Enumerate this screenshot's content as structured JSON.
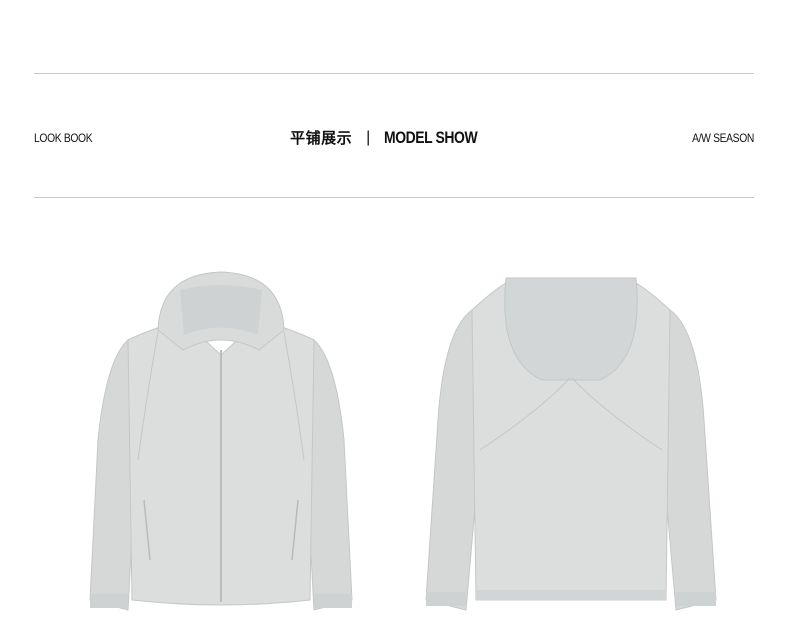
{
  "header": {
    "left_label": "LOOK BOOK",
    "center_cn": "平铺展示",
    "separator": "|",
    "center_en": "MODEL SHOW",
    "right_label": "A/W SEASON"
  },
  "products": [
    {
      "view": "front",
      "icon": "hooded-jacket-front-icon",
      "color": "#d8dada"
    },
    {
      "view": "back",
      "icon": "hooded-jacket-back-icon",
      "color": "#d8dada"
    }
  ],
  "colors": {
    "rule": "#c9c9c9",
    "jacket": "#d8dada",
    "jacket_shadow": "#c6c9c9",
    "text": "#111111"
  }
}
